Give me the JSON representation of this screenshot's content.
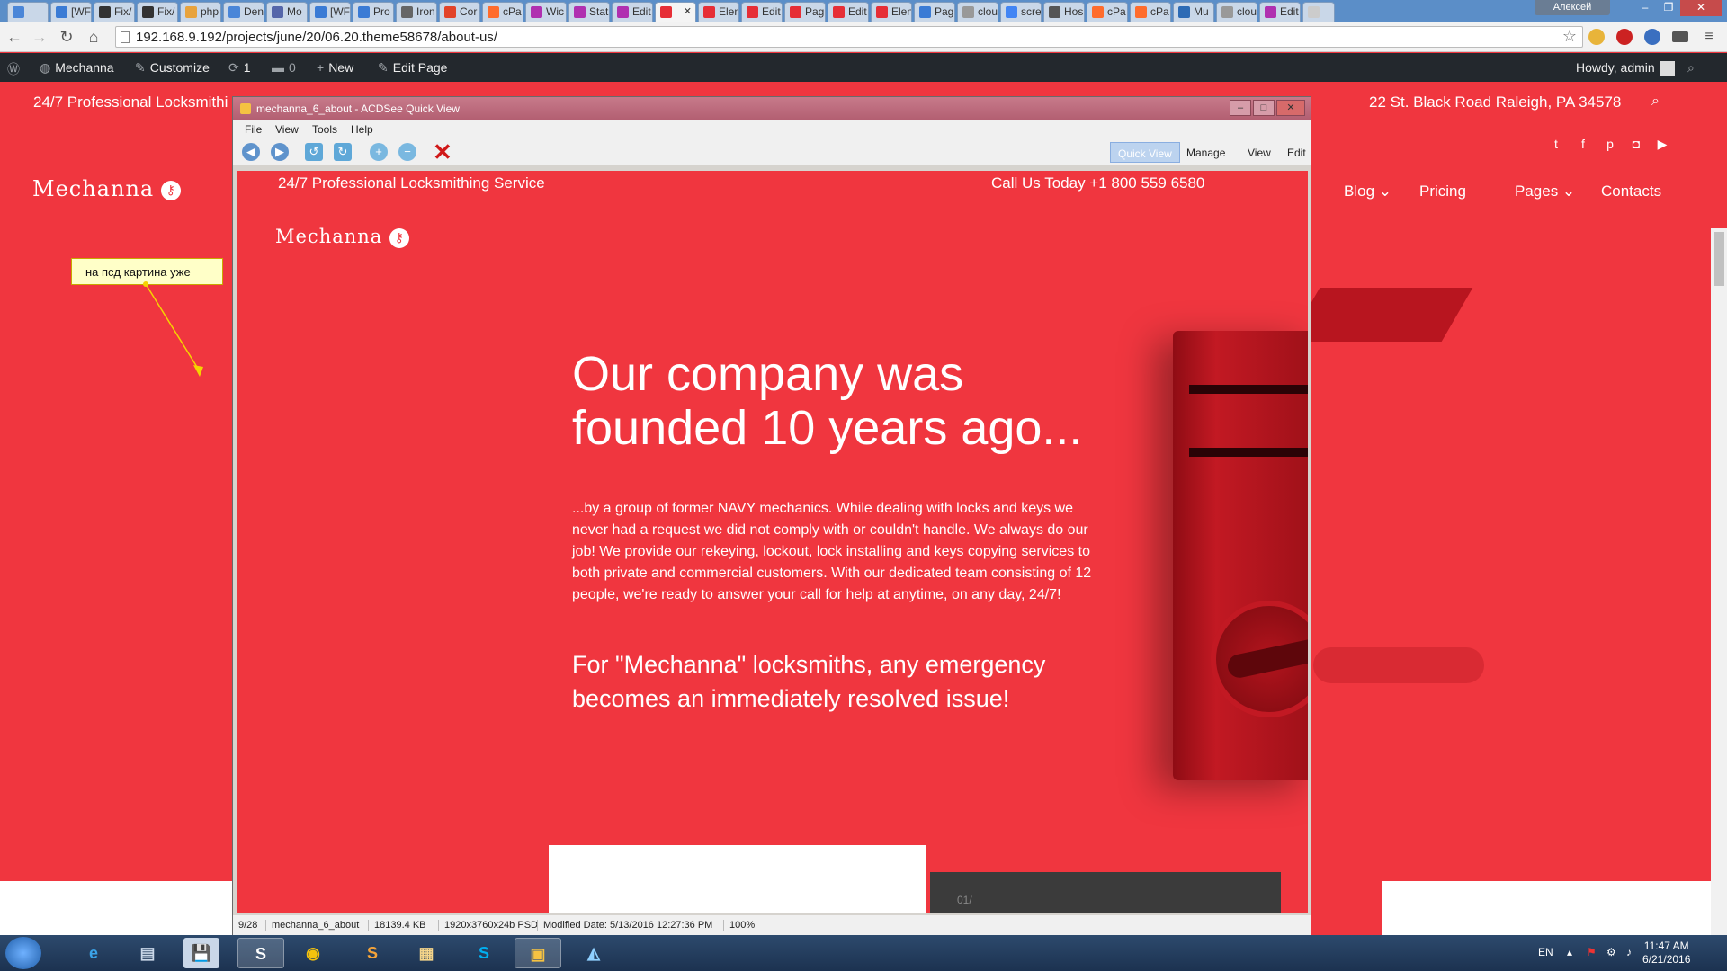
{
  "browser": {
    "tabs": [
      {
        "label": "",
        "color": "#4a86d8"
      },
      {
        "label": "[WF",
        "color": "#3a7bd5"
      },
      {
        "label": "Fix/",
        "color": "#333333"
      },
      {
        "label": "Fix/",
        "color": "#333333"
      },
      {
        "label": "php",
        "color": "#e8a33d"
      },
      {
        "label": "Den",
        "color": "#4a86d8"
      },
      {
        "label": "Mo",
        "color": "#5566aa"
      },
      {
        "label": "[WF",
        "color": "#3a7bd5"
      },
      {
        "label": "Pro",
        "color": "#3a7bd5"
      },
      {
        "label": "Iron",
        "color": "#666666"
      },
      {
        "label": "Cor",
        "color": "#e24329"
      },
      {
        "label": "cPa",
        "color": "#ff6c2c"
      },
      {
        "label": "Wic",
        "color": "#b030b0"
      },
      {
        "label": "Stat",
        "color": "#b030b0"
      },
      {
        "label": "Edit",
        "color": "#b030b0"
      },
      {
        "label": "",
        "color": "#e62e36"
      },
      {
        "label": "Elen",
        "color": "#e62e36"
      },
      {
        "label": "Edit",
        "color": "#e62e36"
      },
      {
        "label": "Pag",
        "color": "#e62e36"
      },
      {
        "label": "Edit",
        "color": "#e62e36"
      },
      {
        "label": "Elen",
        "color": "#e62e36"
      },
      {
        "label": "Pag",
        "color": "#3a7bd5"
      },
      {
        "label": "clou",
        "color": "#999999"
      },
      {
        "label": "scre",
        "color": "#4285f4"
      },
      {
        "label": "Hos",
        "color": "#555555"
      },
      {
        "label": "cPa",
        "color": "#ff6c2c"
      },
      {
        "label": "cPa",
        "color": "#ff6c2c"
      },
      {
        "label": "Mu",
        "color": "#2d6bb5"
      },
      {
        "label": "clou",
        "color": "#999999"
      },
      {
        "label": "Edit",
        "color": "#b030b0"
      },
      {
        "label": "",
        "color": "#cccccc"
      }
    ],
    "user": "Алексей",
    "url": "192.168.9.192/projects/june/20/06.20.theme58678/about-us/"
  },
  "wpbar": {
    "site": "Mechanna",
    "customize": "Customize",
    "updates": "1",
    "comments": "0",
    "new": "New",
    "edit_page": "Edit Page",
    "howdy": "Howdy, admin"
  },
  "site": {
    "tagline": "24/7 Professional Locksmithi",
    "address": "22 St. Black Road Raleigh, PA 34578",
    "logo": "Mechanna",
    "nav": [
      "Blog",
      "Pricing",
      "Pages",
      "Contacts"
    ],
    "note": "на псд картина уже"
  },
  "acdsee": {
    "title": "mechanna_6_about - ACDSee Quick View",
    "menu": [
      "File",
      "View",
      "Tools",
      "Help"
    ],
    "modes": [
      "Quick View",
      "Manage",
      "View",
      "Edit"
    ],
    "status": [
      "9/28",
      "mechanna_6_about",
      "18139.4 KB",
      "1920x3760x24b PSD",
      "Modified Date: 5/13/2016 12:27:36 PM",
      "100%"
    ]
  },
  "image": {
    "tagline": "24/7 Professional Locksmithing Service",
    "phone": "Call Us Today +1 800 559 6580",
    "logo": "Mechanna",
    "title": "Our company was founded 10 years ago...",
    "body": "...by a group of former NAVY mechanics. While dealing with locks and keys we never had a request we did not comply with or couldn't handle. We always do our job! We provide our rekeying, lockout, lock installing and keys copying services to both private and commercial customers. With our dedicated team consisting of 12 people, we're ready to answer your call for help at anytime, on any day, 24/7!",
    "quote": "For \"Mechanna\" locksmiths, any emergency becomes an immediately resolved issue!",
    "slide_num": "01/"
  },
  "taskbar": {
    "lang": "EN",
    "time": "11:47 AM",
    "date": "6/21/2016"
  },
  "colors": {
    "brand": "#f0363f",
    "wpbar": "#23282d"
  }
}
